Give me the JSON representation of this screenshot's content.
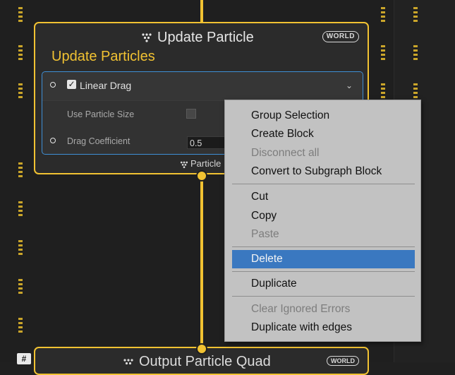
{
  "graph": {
    "update_node": {
      "title": "Update Particle",
      "icon": "particle-system-icon",
      "space_badge": "WORLD",
      "context_label": "Update Particles",
      "block": {
        "title": "Linear Drag",
        "enabled": true,
        "properties": [
          {
            "label": "Use Particle Size",
            "type": "checkbox",
            "checked": false
          },
          {
            "label": "Drag Coefficient",
            "type": "float",
            "value": "0.5"
          }
        ]
      },
      "footer_label": "Particle"
    },
    "output_node": {
      "title": "Output Particle Quad",
      "space_badge": "WORLD"
    },
    "corner_badge": "#"
  },
  "context_menu": {
    "items": [
      {
        "label": "Group Selection",
        "enabled": true
      },
      {
        "label": "Create Block",
        "enabled": true
      },
      {
        "label": "Disconnect all",
        "enabled": false
      },
      {
        "label": "Convert to Subgraph Block",
        "enabled": true
      },
      {
        "label": "Cut",
        "enabled": true
      },
      {
        "label": "Copy",
        "enabled": true
      },
      {
        "label": "Paste",
        "enabled": false
      },
      {
        "label": "Delete",
        "enabled": true,
        "highlighted": true
      },
      {
        "label": "Duplicate",
        "enabled": true
      },
      {
        "label": "Clear Ignored Errors",
        "enabled": false
      },
      {
        "label": "Duplicate with edges",
        "enabled": true
      }
    ]
  },
  "colors": {
    "flow": "#f1c232",
    "selection": "#3f8fd6",
    "menu_highlight": "#3a78c0",
    "canvas": "#1f1f1f"
  }
}
